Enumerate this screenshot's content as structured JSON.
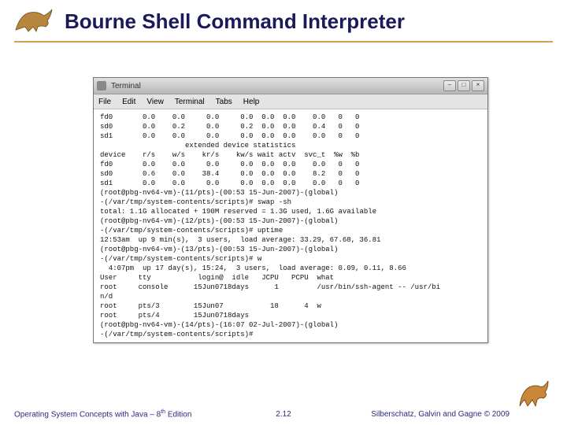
{
  "title": "Bourne Shell Command Interpreter",
  "terminal": {
    "window_title": "Terminal",
    "menus": [
      "File",
      "Edit",
      "View",
      "Terminal",
      "Tabs",
      "Help"
    ],
    "lines": [
      "fd0       0.0    0.0     0.0     0.0  0.0  0.0    0.0   0   0",
      "sd0       0.0    0.2     0.0     0.2  0.0  0.0    0.4   0   0",
      "sd1       0.0    0.0     0.0     0.0  0.0  0.0    0.0   0   0",
      "                    extended device statistics",
      "device    r/s    w/s    kr/s    kw/s wait actv  svc_t  %w  %b",
      "fd0       0.0    0.0     0.0     0.0  0.0  0.0    0.0   0   0",
      "sd0       0.6    0.0    38.4     0.0  0.0  0.0    8.2   0   0",
      "sd1       0.0    0.0     0.0     0.0  0.0  0.0    0.0   0   0",
      "(root@pbg-nv64-vm)-(11/pts)-(00:53 15-Jun-2007)-(global)",
      "-(/var/tmp/system-contents/scripts)# swap -sh",
      "total: 1.1G allocated + 190M reserved = 1.3G used, 1.6G available",
      "(root@pbg-nv64-vm)-(12/pts)-(00:53 15-Jun-2007)-(global)",
      "-(/var/tmp/system-contents/scripts)# uptime",
      "12:53am  up 9 min(s),  3 users,  load average: 33.29, 67.68, 36.81",
      "(root@pbg-nv64-vm)-(13/pts)-(00:53 15-Jun-2007)-(global)",
      "-(/var/tmp/system-contents/scripts)# w",
      "  4:07pm  up 17 day(s), 15:24,  3 users,  load average: 0.09, 0.11, 8.66",
      "User     tty           login@  idle   JCPU   PCPU  what",
      "root     console      15Jun0718days      1         /usr/bin/ssh-agent -- /usr/bi",
      "n/d",
      "root     pts/3        15Jun07           18      4  w",
      "root     pts/4        15Jun0718days",
      "(root@pbg-nv64-vm)-(14/pts)-(16:07 02-Jul-2007)-(global)",
      "-(/var/tmp/system-contents/scripts)#"
    ]
  },
  "footer": {
    "left_prefix": "Operating System Concepts with Java – 8",
    "left_sup": "th",
    "left_suffix": " Edition",
    "center": "2.12",
    "right": "Silberschatz, Galvin and Gagne © 2009"
  },
  "icons": {
    "dino_top": "dinosaur-icon",
    "dino_bottom": "dinosaur-icon"
  }
}
